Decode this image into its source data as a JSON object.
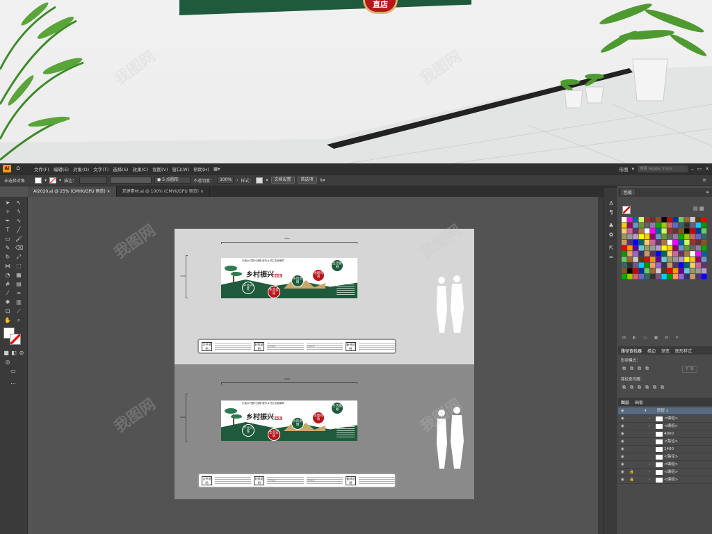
{
  "photo": {
    "seal_text": "直店"
  },
  "menubar": {
    "app_logo": "Ai",
    "items": [
      "文件(F)",
      "编辑(E)",
      "对象(O)",
      "文字(T)",
      "选择(S)",
      "效果(C)",
      "视图(V)",
      "窗口(W)",
      "帮助(H)"
    ],
    "workspace": "形图",
    "search_placeholder": "搜索 Adobe Stock"
  },
  "controlbar": {
    "selection_status": "未选择对象",
    "stroke_label": "描边：",
    "brush_label": "5 点圆形",
    "opacity_label": "不透明度：",
    "opacity_value": "100%",
    "style_label": "样式：",
    "doc_setup_button": "文档设置",
    "prefs_button": "首选项"
  },
  "tabs": [
    {
      "label": "AI2020.ai @ 25% (CMYK/GPU 预览)",
      "active": true
    },
    {
      "label": "党建素材.ai @ 100% (CMYK/GPU 预览)",
      "active": false
    }
  ],
  "artboard": {
    "title": "乡村振兴",
    "title_tag": "新篇",
    "header_line": "乐施乡村振兴战略    谱写乡村生态新篇章",
    "circles": [
      "产业兴旺",
      "生态宜居",
      "乡风文明",
      "治理有效",
      "生活富裕"
    ],
    "base_labels": [
      "文件说明",
      "材质说明",
      "板材说明"
    ],
    "base_mid": [
      "示范材质",
      "高规材质"
    ],
    "dim_width": "4000",
    "dim_height": "1400"
  },
  "swatches_panel": {
    "title": "色板"
  },
  "pathfinder_panel": {
    "tabs": [
      "路径查找器",
      "描边",
      "渐变",
      "图形样式"
    ],
    "shape_modes": "形状模式：",
    "expand_button": "扩展",
    "pathfinders": "路径查找器："
  },
  "layers_panel": {
    "tabs": [
      "图层",
      "画板"
    ],
    "rows": [
      "图层 1",
      "<编组>",
      "<编组>",
      "4000",
      "<路径>",
      "1400",
      "<路径>",
      "<编组>",
      "<编组>",
      "<编组>"
    ]
  },
  "watermark": "我图网",
  "colors": {
    "accent": "#1e5a3b",
    "ui_dark": "#3a3a3a",
    "ui_canvas": "#535353",
    "ai_orange": "#ff9a00"
  }
}
